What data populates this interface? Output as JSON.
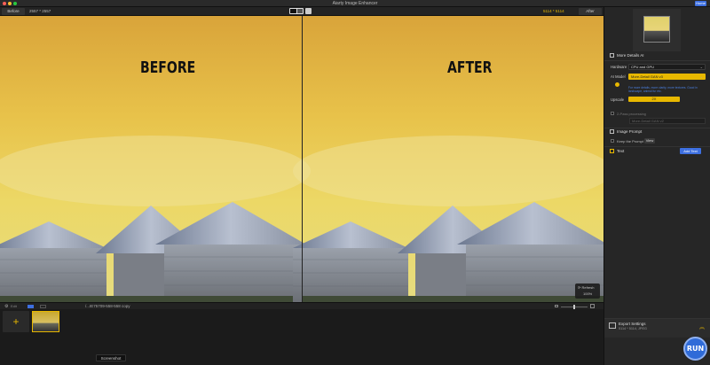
{
  "window": {
    "title": "Aiarty Image Enhancer",
    "home_label": "Home"
  },
  "toolbar": {
    "before_label": "Before",
    "before_dims": "2557 * 2557",
    "after_dims": "5114 * 5114",
    "after_label": "After"
  },
  "viewer": {
    "before_text": "BEFORE",
    "after_text": "AFTER",
    "refresh_label": "Refresh",
    "zoom": "100%"
  },
  "bottom": {
    "edit_label": "Edit",
    "file_name": "/...IE75709-558-558 copy"
  },
  "filmstrip": {
    "add_label": "+",
    "tooltip": "Screenshot"
  },
  "panel": {
    "more_details_label": "More Details AI",
    "hardware_label": "Hardware",
    "hardware_value": "CPU and GPU",
    "ai_model_label": "AI Model",
    "ai_model_value": "More-Detail GAN v3",
    "ai_model_desc": "For more details, more clarity, more textures. Good in landscape, animal fur etc.",
    "upscale_label": "Upscale",
    "upscale_value": "2X",
    "two_pass_label": "2-Pass processing",
    "two_pass_value": "More-Detail GAN v2",
    "image_prompt_label": "Image Prompt",
    "keep_prompt_label": "Keep the Prompt",
    "view_label": "View",
    "text_label": "Text",
    "add_text_label": "Add Text",
    "export_label": "Export Settings",
    "export_sub": "5114 * 5114, JPEG",
    "run_label": "RUN"
  },
  "colors": {
    "accent": "#e8b800",
    "primary": "#3d6fe0"
  }
}
